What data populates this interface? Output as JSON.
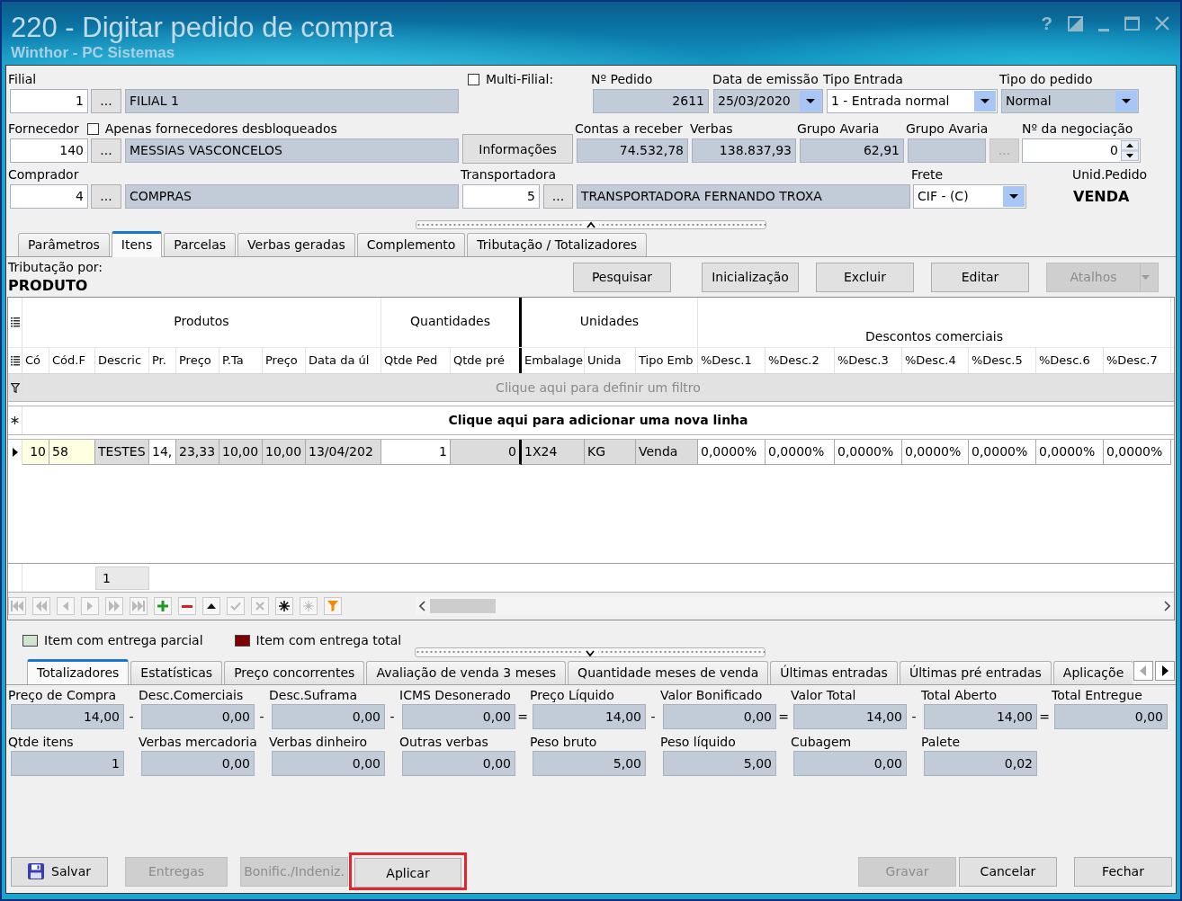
{
  "window": {
    "title": "220 - Digitar pedido de compra",
    "subtitle": "Winthor - PC Sistemas",
    "help": "?"
  },
  "header": {
    "rows": [
      {
        "groups": [
          {
            "label": "Filial",
            "controls": [
              {
                "kind": "number",
                "value": "1",
                "readonly": false
              },
              {
                "kind": "lookup",
                "text": "...",
                "disabled": false
              },
              {
                "kind": "text",
                "value": "FILIAL 1",
                "readonly": true
              }
            ]
          },
          {
            "checkbox": {
              "label": "Multi-Filial:",
              "checked": false
            }
          },
          {
            "label": "Nº Pedido",
            "controls": [
              {
                "kind": "number",
                "value": "2611",
                "readonly": true
              }
            ]
          },
          {
            "label": "Data de emissão",
            "controls": [
              {
                "kind": "dropdown",
                "value": "25/03/2020",
                "readonly": true
              }
            ]
          },
          {
            "label": "Tipo Entrada",
            "controls": [
              {
                "kind": "dropdown",
                "value": "1 - Entrada normal",
                "readonly": false
              }
            ]
          },
          {
            "label": "Tipo do pedido",
            "controls": [
              {
                "kind": "dropdown",
                "value": "Normal",
                "readonly": true
              }
            ]
          }
        ]
      },
      {
        "groups": [
          {
            "label": "Fornecedor",
            "checkbox": {
              "label": "Apenas fornecedores desbloqueados",
              "checked": false
            },
            "controls": [
              {
                "kind": "number",
                "value": "140",
                "readonly": false
              },
              {
                "kind": "lookup",
                "text": "...",
                "disabled": false
              },
              {
                "kind": "text",
                "value": "MESSIAS VASCONCELOS",
                "readonly": true
              }
            ]
          },
          {
            "controls": [
              {
                "kind": "button",
                "text": "Informações",
                "disabled": false
              }
            ]
          },
          {
            "label": "Contas a receber",
            "controls": [
              {
                "kind": "number",
                "value": "74.532,78",
                "readonly": true
              }
            ]
          },
          {
            "label": "Verbas",
            "controls": [
              {
                "kind": "number",
                "value": "138.837,93",
                "readonly": true
              }
            ]
          },
          {
            "label": "Grupo Avaria",
            "controls": [
              {
                "kind": "number",
                "value": "62,91",
                "readonly": true
              }
            ]
          },
          {
            "label": "Grupo Avaria",
            "controls": [
              {
                "kind": "text",
                "readonly": true
              },
              {
                "kind": "lookup",
                "text": "...",
                "disabled": true
              }
            ]
          },
          {
            "label": "Nº da negociação",
            "controls": [
              {
                "kind": "spinner",
                "value": "0",
                "readonly": false
              }
            ]
          }
        ]
      },
      {
        "groups": [
          {
            "label": "Comprador",
            "controls": [
              {
                "kind": "number",
                "value": "4",
                "readonly": false
              },
              {
                "kind": "lookup",
                "text": "...",
                "disabled": false
              },
              {
                "kind": "text",
                "value": "COMPRAS",
                "readonly": true
              }
            ]
          },
          {
            "label": "Transportadora",
            "controls": [
              {
                "kind": "number",
                "value": "5",
                "readonly": false
              },
              {
                "kind": "lookup",
                "text": "...",
                "disabled": false
              },
              {
                "kind": "text",
                "value": "TRANSPORTADORA FERNANDO TROXA",
                "readonly": true
              }
            ]
          },
          {
            "label": "Frete",
            "controls": [
              {
                "kind": "dropdown",
                "value": "CIF - (C)",
                "readonly": false
              }
            ]
          },
          {
            "label": "Unid.Pedido",
            "controls": [
              {
                "kind": "display",
                "value": "VENDA"
              }
            ]
          }
        ]
      }
    ]
  },
  "tabs": [
    {
      "label": "Parâmetros",
      "selected": false
    },
    {
      "label": "Itens",
      "selected": true
    },
    {
      "label": "Parcelas",
      "selected": false
    },
    {
      "label": "Verbas geradas",
      "selected": false
    },
    {
      "label": "Complemento",
      "selected": false
    },
    {
      "label": "Tributação / Totalizadores",
      "selected": false
    }
  ],
  "itens": {
    "tributacao_label": "Tributação por:",
    "tributacao_value": "PRODUTO",
    "toolbar": [
      {
        "label": "Pesquisar",
        "kind": "plain",
        "disabled": false
      },
      {
        "label": "Inicialização",
        "kind": "plain",
        "disabled": false
      },
      {
        "label": "Excluir",
        "kind": "plain",
        "disabled": false
      },
      {
        "label": "Editar",
        "kind": "plain",
        "disabled": false
      },
      {
        "label": "Atalhos",
        "kind": "split",
        "disabled": true
      }
    ],
    "grid": {
      "bands": [
        {
          "label": "Produtos",
          "columns": [
            "Có",
            "Cód.F",
            "Descric",
            "Pr.",
            "Preço",
            "P.Ta",
            "Preço",
            "Data da úl"
          ]
        },
        {
          "label": "Quantidades",
          "columns": [
            "Qtde Ped",
            "Qtde pré"
          ]
        },
        {
          "label": "Unidades",
          "columns": [
            "Embalage",
            "Unida",
            "Tipo Emb"
          ]
        },
        {
          "label": "Descontos comerciais",
          "columns": [
            "%Desc.1",
            "%Desc.2",
            "%Desc.3",
            "%Desc.4",
            "%Desc.5",
            "%Desc.6",
            "%Desc.7"
          ]
        }
      ],
      "filter_prompt": "Clique aqui para definir um filtro",
      "new_row_prompt": "Clique aqui para adicionar uma nova linha",
      "rows": [
        {
          "selected": true,
          "cells": [
            {
              "text": "10",
              "kind": "key"
            },
            {
              "text": "58",
              "kind": "key"
            },
            {
              "text": "TESTES",
              "kind": "readonly"
            },
            {
              "text": "14,",
              "kind": "editable"
            },
            {
              "text": "23,33",
              "kind": "readonly"
            },
            {
              "text": "10,00",
              "kind": "readonly"
            },
            {
              "text": "10,00",
              "kind": "readonly"
            },
            {
              "text": "13/04/202",
              "kind": "readonly"
            },
            {
              "text": "1",
              "kind": "editable"
            },
            {
              "text": "0",
              "kind": "readonly"
            },
            {
              "text": "1X24",
              "kind": "readonly"
            },
            {
              "text": "KG",
              "kind": "readonly"
            },
            {
              "text": "Venda",
              "kind": "readonly"
            },
            {
              "text": "0,0000%",
              "kind": "editable"
            },
            {
              "text": "0,0000%",
              "kind": "editable"
            },
            {
              "text": "0,0000%",
              "kind": "editable"
            },
            {
              "text": "0,0000%",
              "kind": "editable"
            },
            {
              "text": "0,0000%",
              "kind": "editable"
            },
            {
              "text": "0,0000%",
              "kind": "editable"
            },
            {
              "text": "0,0000%",
              "kind": "editable"
            }
          ]
        }
      ],
      "summary": "1",
      "navigator": {
        "buttons": [
          {
            "disabled": true
          },
          {
            "disabled": true
          },
          {
            "disabled": true
          },
          {
            "disabled": true
          },
          {
            "disabled": true
          },
          {
            "disabled": true
          },
          {
            "disabled": false
          },
          {
            "disabled": false
          },
          {
            "disabled": false
          },
          {
            "disabled": true
          },
          {
            "disabled": true
          },
          {
            "disabled": false
          },
          {
            "disabled": true
          },
          {
            "disabled": false
          }
        ]
      }
    },
    "legend": [
      {
        "label": "Item com entrega parcial",
        "color": "#cde6cd"
      },
      {
        "label": "Item com entrega total",
        "color": "#800000"
      }
    ]
  },
  "lower_tabs": [
    {
      "label": "Totalizadores",
      "selected": true
    },
    {
      "label": "Estatísticas",
      "selected": false
    },
    {
      "label": "Preço concorrentes",
      "selected": false
    },
    {
      "label": "Avaliação de venda 3 meses",
      "selected": false
    },
    {
      "label": "Quantidade meses de venda",
      "selected": false
    },
    {
      "label": "Últimas entradas",
      "selected": false
    },
    {
      "label": "Últimas pré entradas",
      "selected": false
    },
    {
      "label": "Aplicaçõe",
      "selected": false
    }
  ],
  "lower_tab_scroll": [
    {
      "disabled": true
    },
    {
      "disabled": false
    }
  ],
  "totals": {
    "rows": [
      {
        "items": [
          {
            "kind": "field",
            "label": "Preço de Compra",
            "value": "14,00"
          },
          {
            "kind": "operator",
            "text": "-"
          },
          {
            "kind": "field",
            "label": "Desc.Comerciais",
            "value": "0,00"
          },
          {
            "kind": "operator",
            "text": "-"
          },
          {
            "kind": "field",
            "label": "Desc.Suframa",
            "value": "0,00"
          },
          {
            "kind": "operator",
            "text": "-"
          },
          {
            "kind": "field",
            "label": "ICMS Desonerado",
            "value": "0,00"
          },
          {
            "kind": "operator",
            "text": "="
          },
          {
            "kind": "field",
            "label": "Preço Líquido",
            "value": "14,00"
          },
          {
            "kind": "operator",
            "text": "-"
          },
          {
            "kind": "field",
            "label": "Valor Bonificado",
            "value": "0,00"
          },
          {
            "kind": "operator",
            "text": "="
          },
          {
            "kind": "field",
            "label": "Valor Total",
            "value": "14,00"
          },
          {
            "kind": "operator",
            "text": "-"
          },
          {
            "kind": "field",
            "label": "Total Aberto",
            "value": "14,00"
          },
          {
            "kind": "operator",
            "text": "="
          },
          {
            "kind": "field",
            "label": "Total Entregue",
            "value": "0,00"
          }
        ]
      },
      {
        "items": [
          {
            "kind": "field",
            "label": "Qtde itens",
            "value": "1"
          },
          {
            "kind": "field",
            "label": "Verbas mercadoria",
            "value": "0,00"
          },
          {
            "kind": "field",
            "label": "Verbas dinheiro",
            "value": "0,00"
          },
          {
            "kind": "field",
            "label": "Outras verbas",
            "value": "0,00"
          },
          {
            "kind": "field",
            "label": "Peso bruto",
            "value": "5,00"
          },
          {
            "kind": "field",
            "label": "Peso líquido",
            "value": "5,00"
          },
          {
            "kind": "field",
            "label": "Cubagem",
            "value": "0,00"
          },
          {
            "kind": "field",
            "label": "Palete",
            "value": "0,02"
          }
        ]
      }
    ]
  },
  "footer": {
    "left": [
      {
        "label": "Salvar",
        "kind": "icon",
        "disabled": false,
        "highlighted": false
      },
      {
        "label": "Entregas",
        "kind": "plain",
        "disabled": true,
        "highlighted": false
      },
      {
        "label": "Bonific./Indeniz.",
        "kind": "plain",
        "disabled": true,
        "highlighted": false
      },
      {
        "label": "Aplicar",
        "kind": "plain",
        "disabled": false,
        "highlighted": true
      }
    ],
    "right": [
      {
        "label": "Gravar",
        "kind": "plain",
        "disabled": true,
        "highlighted": false
      },
      {
        "label": "Cancelar",
        "kind": "plain",
        "disabled": false,
        "highlighted": false
      },
      {
        "label": "Fechar",
        "kind": "plain",
        "disabled": false,
        "highlighted": false
      }
    ]
  }
}
